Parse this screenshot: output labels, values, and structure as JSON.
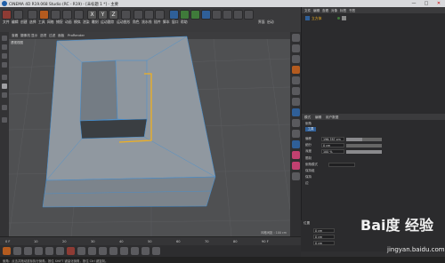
{
  "window": {
    "title": "CINEMA 4D R19.068 Studio (RC - R19) - [未标题 1 *] - 主要",
    "controls": [
      "—",
      "□",
      "✕"
    ]
  },
  "menus": [
    "文件",
    "编辑",
    "创建",
    "选择",
    "工具",
    "网格",
    "捕捉",
    "动画",
    "模拟",
    "渲染",
    "雕刻",
    "运动跟踪",
    "运动图形",
    "角色",
    "流水线",
    "插件",
    "脚本",
    "窗口",
    "帮助",
    "界面",
    "启动"
  ],
  "toolbar_axes": [
    "X",
    "Y",
    "Z"
  ],
  "viewport": {
    "menu": [
      "查看",
      "摄像机",
      "显示",
      "选项",
      "过滤",
      "面板",
      "ProRender"
    ],
    "label": "透视视图",
    "footer": "网格间距 : 100 cm"
  },
  "object_manager": {
    "tabs": [
      "文件",
      "编辑",
      "查看",
      "对象",
      "标签",
      "书签"
    ],
    "object_name": "立方体"
  },
  "attributes": {
    "tabs": [
      "模式",
      "编辑",
      "用户数据"
    ],
    "title": "倒角",
    "subtab": "工具",
    "rows": [
      {
        "label": "偏移",
        "value": "196.787 cm",
        "fill": 0.45
      },
      {
        "label": "细分",
        "value": "0 cm",
        "fill": 0.0
      },
      {
        "label": "深度",
        "value": "100 %",
        "fill": 1.0
      }
    ],
    "extra_rows": [
      "限制",
      "倒角模式",
      "保持组",
      "保持",
      "边"
    ]
  },
  "coordinates": {
    "header": "位置",
    "values": [
      "0 cm",
      "0 cm",
      "0 cm"
    ]
  },
  "timeline": {
    "labels": [
      "0 F",
      "10",
      "20",
      "30",
      "40",
      "50",
      "60",
      "70",
      "80",
      "90 F"
    ]
  },
  "statusbar": {
    "text": "倒角：点击并拖动鼠标执行倒角。按住 SHIFT 键量化倒角，按住 Ctrl 键复制。"
  },
  "watermark": {
    "brand": "Bai度 经验",
    "url": "jingyan.baidu.com"
  },
  "colors": {
    "selection_yellow": "#f0b020",
    "edge_blue": "#3f8fd6",
    "mesh_gray": "#8c949b"
  }
}
